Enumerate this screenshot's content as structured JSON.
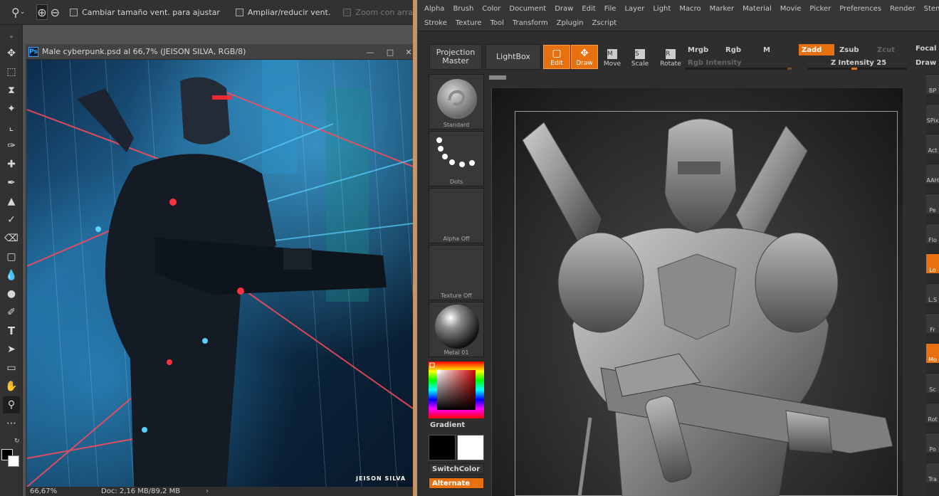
{
  "photoshop": {
    "options_bar": {
      "checkbox_resize": "Cambiar tamaño vent. para ajustar",
      "checkbox_zoom_all": "Ampliar/reducir vent.",
      "checkbox_scrubby": "Zoom con arrastre"
    },
    "document": {
      "title": "Male cyberpunk.psd al 66,7% (JEISON SILVA, RGB/8)",
      "watermark": "JEISON SILVA"
    },
    "status": {
      "zoom": "66,67%",
      "doc_size": "Doc: 2,16 MB/89,2 MB"
    },
    "tools": [
      "move-icon",
      "marquee-icon",
      "lasso-icon",
      "quick-select-icon",
      "crop-icon",
      "eyedropper-icon",
      "healing-icon",
      "brush-icon",
      "stamp-icon",
      "history-brush-icon",
      "eraser-icon",
      "gradient-icon",
      "blur-icon",
      "dodge-icon",
      "pen-icon",
      "type-icon",
      "path-select-icon",
      "rectangle-icon",
      "hand-icon",
      "zoom-icon",
      "more-icon"
    ]
  },
  "zbrush": {
    "menu_row1": [
      "Alpha",
      "Brush",
      "Color",
      "Document",
      "Draw",
      "Edit",
      "File",
      "Layer",
      "Light",
      "Macro",
      "Marker",
      "Material",
      "Movie",
      "Picker",
      "Preferences",
      "Render",
      "Stencil"
    ],
    "menu_row2": [
      "Stroke",
      "Texture",
      "Tool",
      "Transform",
      "Zplugin",
      "Zscript"
    ],
    "shelf": {
      "projection_master": "Projection Master",
      "lightbox": "LightBox",
      "edit": "Edit",
      "draw": "Draw",
      "move": "Move",
      "scale": "Scale",
      "rotate": "Rotate",
      "mrgb": "Mrgb",
      "rgb": "Rgb",
      "m": "M",
      "zadd": "Zadd",
      "zsub": "Zsub",
      "zcut": "Zcut",
      "rgb_intensity": "Rgb Intensity",
      "z_intensity": "Z Intensity 25",
      "focal": "Focal",
      "draw_size": "Draw"
    },
    "left_panel": {
      "brush": "Standard",
      "stroke": "Dots",
      "alpha": "Alpha Off",
      "texture": "Texture Off",
      "material": "Metal 01",
      "gradient": "Gradient",
      "switch_color": "SwitchColor",
      "alternate": "Alternate"
    },
    "right_tray": [
      "BP",
      "SPix",
      "Act",
      "AAH",
      "Pe",
      "Flo",
      "Lo",
      "L.S",
      "Fr",
      "Mo",
      "Sc",
      "Rot",
      "Po",
      "Tra"
    ],
    "colors": {
      "accent": "#e7700f",
      "primary_swatch": "#000000",
      "secondary_swatch": "#ffffff"
    }
  }
}
